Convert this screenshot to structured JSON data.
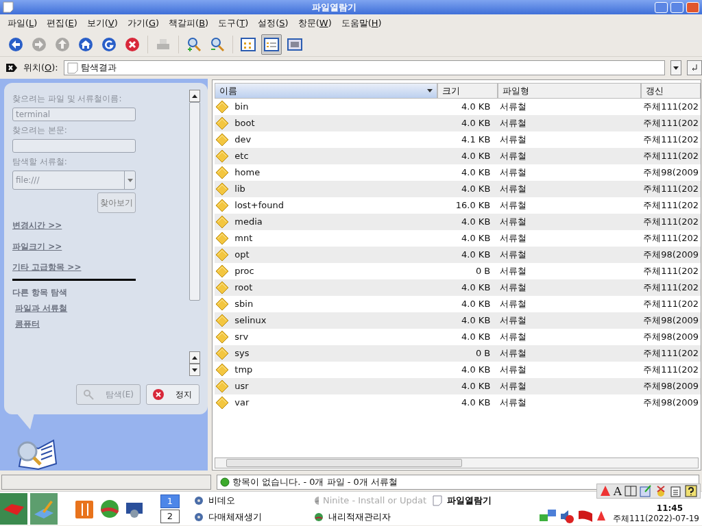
{
  "window": {
    "title": "파일열람기"
  },
  "menu": [
    "파일(L)",
    "편집(E)",
    "보기(V)",
    "가기(G)",
    "책갈피(B)",
    "도구(T)",
    "설정(S)",
    "창문(W)",
    "도움말(H)"
  ],
  "toolbar": [
    {
      "kind": "back",
      "disabled": false,
      "selected": false
    },
    {
      "kind": "forward",
      "disabled": true,
      "selected": false
    },
    {
      "kind": "up",
      "disabled": true,
      "selected": false
    },
    {
      "kind": "home",
      "disabled": false,
      "selected": false
    },
    {
      "kind": "reload",
      "disabled": false,
      "selected": false
    },
    {
      "kind": "stop",
      "disabled": false,
      "selected": false
    },
    {
      "kind": "print",
      "disabled": true,
      "selected": false
    },
    {
      "kind": "zoom-in",
      "disabled": false,
      "selected": false
    },
    {
      "kind": "zoom-out",
      "disabled": false,
      "selected": false
    },
    {
      "kind": "icon-view",
      "disabled": false,
      "selected": false
    },
    {
      "kind": "detail-view",
      "disabled": false,
      "selected": true
    },
    {
      "kind": "image-view",
      "disabled": false,
      "selected": false
    }
  ],
  "location": {
    "label": "위치(O):",
    "value": "탐색결과"
  },
  "search_panel": {
    "name_label": "찾으려는 파일 및 서류철이름:",
    "name_value": "terminal",
    "text_label": "찾으려는 본문:",
    "folder_label": "탐색할 서류철:",
    "folder_value": "file:///",
    "browse_button": "찾아보기",
    "links": [
      "변경시간  >>",
      "파일크기  >>",
      "기타 고급항목  >>"
    ],
    "other_heading": "다른 항목 탐색",
    "other_links": [
      "파일과 서류철",
      "콤퓨터"
    ],
    "search_button": {
      "label": "탐색(E)",
      "disabled": true
    },
    "stop_button": {
      "label": "정지",
      "disabled": false
    }
  },
  "table": {
    "columns": [
      {
        "label": "이름",
        "sorted": true
      },
      {
        "label": "크기",
        "sorted": false
      },
      {
        "label": "파일형",
        "sorted": false
      },
      {
        "label": "갱신",
        "sorted": false
      }
    ],
    "rows": [
      {
        "name": "bin",
        "size": "4.0 KB",
        "type": "서류철",
        "modified": "주체111(202"
      },
      {
        "name": "boot",
        "size": "4.0 KB",
        "type": "서류철",
        "modified": "주체111(202"
      },
      {
        "name": "dev",
        "size": "4.1 KB",
        "type": "서류철",
        "modified": "주체111(202"
      },
      {
        "name": "etc",
        "size": "4.0 KB",
        "type": "서류철",
        "modified": "주체111(202"
      },
      {
        "name": "home",
        "size": "4.0 KB",
        "type": "서류철",
        "modified": "주체98(2009"
      },
      {
        "name": "lib",
        "size": "4.0 KB",
        "type": "서류철",
        "modified": "주체111(202"
      },
      {
        "name": "lost+found",
        "size": "16.0 KB",
        "type": "서류철",
        "modified": "주체111(202"
      },
      {
        "name": "media",
        "size": "4.0 KB",
        "type": "서류철",
        "modified": "주체111(202"
      },
      {
        "name": "mnt",
        "size": "4.0 KB",
        "type": "서류철",
        "modified": "주체111(202"
      },
      {
        "name": "opt",
        "size": "4.0 KB",
        "type": "서류철",
        "modified": "주체98(2009"
      },
      {
        "name": "proc",
        "size": "0 B",
        "type": "서류철",
        "modified": "주체111(202"
      },
      {
        "name": "root",
        "size": "4.0 KB",
        "type": "서류철",
        "modified": "주체111(202"
      },
      {
        "name": "sbin",
        "size": "4.0 KB",
        "type": "서류철",
        "modified": "주체111(202"
      },
      {
        "name": "selinux",
        "size": "4.0 KB",
        "type": "서류철",
        "modified": "주체98(2009"
      },
      {
        "name": "srv",
        "size": "4.0 KB",
        "type": "서류철",
        "modified": "주체98(2009"
      },
      {
        "name": "sys",
        "size": "0 B",
        "type": "서류철",
        "modified": "주체111(202"
      },
      {
        "name": "tmp",
        "size": "4.0 KB",
        "type": "서류철",
        "modified": "주체111(202"
      },
      {
        "name": "usr",
        "size": "4.0 KB",
        "type": "서류철",
        "modified": "주체98(2009"
      },
      {
        "name": "var",
        "size": "4.0 KB",
        "type": "서류철",
        "modified": "주체98(2009"
      }
    ]
  },
  "status": "항목이 없습니다. - 0개 파일 - 0개 서류철",
  "taskbar": {
    "pager": [
      {
        "label": "1",
        "selected": true
      },
      {
        "label": "2",
        "selected": false
      }
    ],
    "tasks": [
      {
        "label": "비데오",
        "kind": "player",
        "active": false,
        "disabled": false
      },
      {
        "label": "Ninite - Install or Updat",
        "kind": "globe",
        "active": false,
        "disabled": true
      },
      {
        "label": "파일열람기",
        "kind": "document",
        "active": true,
        "disabled": false
      },
      {
        "label": "다매체재생기",
        "kind": "player",
        "active": false,
        "disabled": false
      },
      {
        "label": "내리적재관리자",
        "kind": "globe",
        "active": false,
        "disabled": false
      }
    ],
    "input_toolbar_glyph": "A",
    "clock": "11:45",
    "date": "주체111(2022)-07-19"
  }
}
